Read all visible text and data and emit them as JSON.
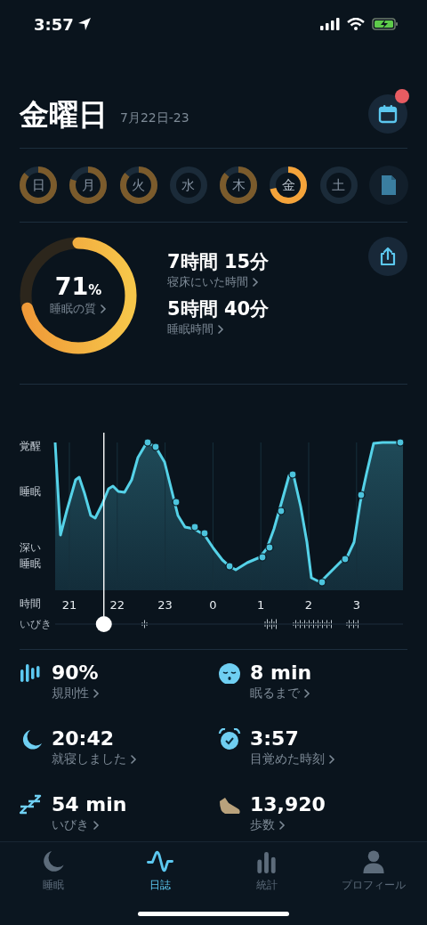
{
  "status_bar": {
    "time": "3:57"
  },
  "header": {
    "title": "金曜日",
    "date_range": "7月22日-23",
    "notification_dot": true
  },
  "days": [
    {
      "label": "日",
      "level": 0.86,
      "selected": false
    },
    {
      "label": "月",
      "level": 0.8,
      "selected": false
    },
    {
      "label": "火",
      "level": 0.86,
      "selected": false
    },
    {
      "label": "水",
      "selected": false
    },
    {
      "label": "木",
      "level": 0.86,
      "selected": false
    },
    {
      "label": "金",
      "level": 0.71,
      "selected": true
    },
    {
      "label": "土",
      "selected": false
    }
  ],
  "summary": {
    "quality": {
      "value": "71",
      "unit": "%",
      "label": "睡眠の質",
      "level": 0.71
    },
    "metrics": [
      {
        "value": "7時間 15分",
        "label": "寝床にいた時間"
      },
      {
        "value": "5時間 40分",
        "label": "睡眠時間"
      }
    ]
  },
  "hypnogram": {
    "stage_labels": [
      "覚醒",
      "睡眠",
      "深い睡眠"
    ],
    "time_label": "時間",
    "hours": [
      "21",
      "22",
      "23",
      "0",
      "1",
      "2",
      "3"
    ],
    "snore_label": "いびき",
    "playhead": {
      "level": 0.14
    }
  },
  "stats": [
    {
      "kind": "regularity",
      "value": "90%",
      "label": "規則性"
    },
    {
      "kind": "fall_asleep",
      "value": "8 min",
      "label": "眠るまで"
    },
    {
      "kind": "bedtime",
      "value": "20:42",
      "label": "就寝しました"
    },
    {
      "kind": "wake",
      "value": "3:57",
      "label": "目覚めた時刻"
    },
    {
      "kind": "snore",
      "value": "54 min",
      "label": "いびき"
    },
    {
      "kind": "steps",
      "value": "13,920",
      "label": "歩数"
    }
  ],
  "tab_bar": [
    {
      "label": "睡眠",
      "selected": false
    },
    {
      "label": "日誌",
      "selected": true
    },
    {
      "label": "統計",
      "selected": false
    },
    {
      "label": "プロフィール",
      "selected": false
    }
  ]
}
